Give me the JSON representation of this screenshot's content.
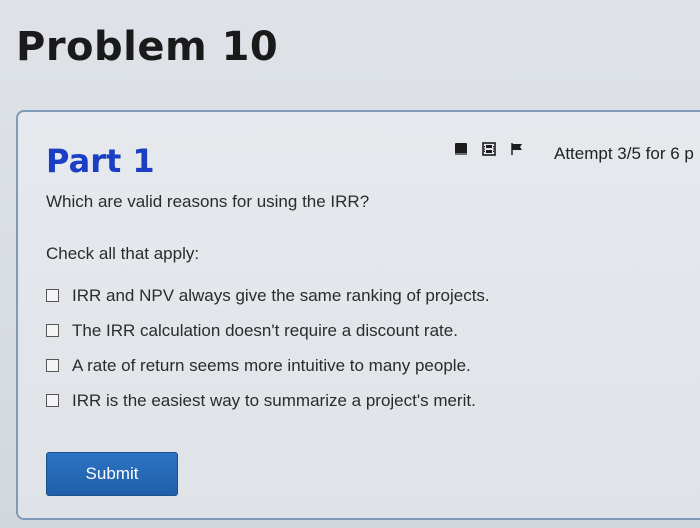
{
  "problem": {
    "title": "Problem 10"
  },
  "part": {
    "title": "Part 1",
    "attempt_text": "Attempt 3/5 for 6 p"
  },
  "toolbar": {
    "icons": [
      "book-icon",
      "film-icon",
      "flag-icon"
    ]
  },
  "question": {
    "text": "Which are valid reasons for using the IRR?",
    "instruction": "Check all that apply:",
    "options": [
      {
        "label": "IRR and NPV always give the same ranking of projects.",
        "checked": false
      },
      {
        "label": "The IRR calculation doesn't require a discount rate.",
        "checked": false
      },
      {
        "label": "A rate of return seems more intuitive to many people.",
        "checked": false
      },
      {
        "label": "IRR is the easiest way to summarize a project's merit.",
        "checked": false
      }
    ]
  },
  "actions": {
    "submit_label": "Submit"
  },
  "colors": {
    "part_title": "#1a3fc4",
    "submit_bg": "#1f5fa8",
    "card_border": "#7f9bb8"
  }
}
